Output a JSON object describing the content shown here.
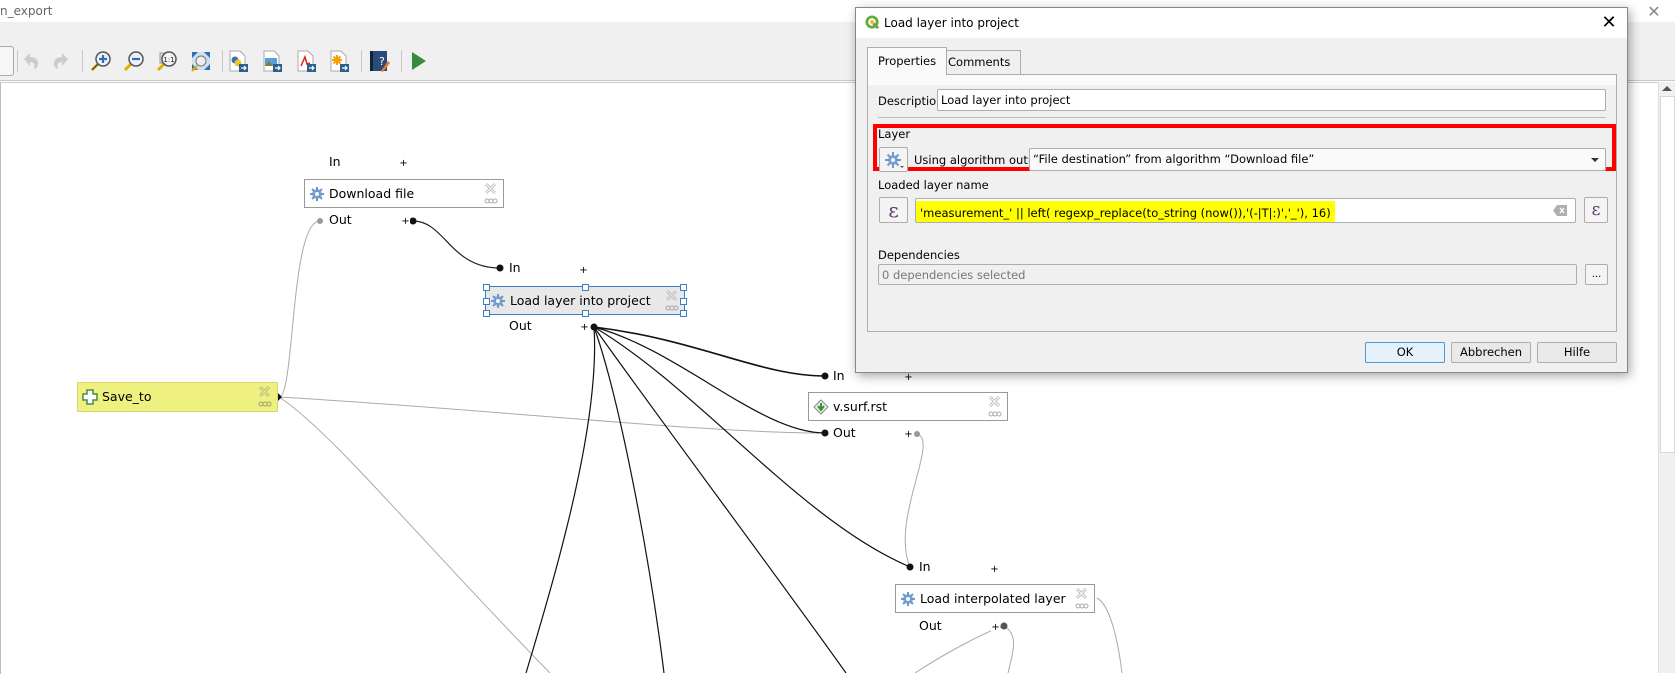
{
  "window": {
    "title": "n_export",
    "close_glyph": "✕"
  },
  "toolbar": {
    "items": [
      {
        "name": "undo",
        "icon": "undo-icon",
        "enabled": false
      },
      {
        "name": "redo",
        "icon": "redo-icon",
        "enabled": false
      },
      {
        "name": "zoom-in",
        "icon": "zoom-in-icon"
      },
      {
        "name": "zoom-out",
        "icon": "zoom-out-icon"
      },
      {
        "name": "zoom-actual",
        "icon": "zoom-actual-size-icon",
        "text": "1:1"
      },
      {
        "name": "zoom-full",
        "icon": "zoom-full-extent-icon"
      },
      {
        "name": "export-python",
        "icon": "export-python-icon"
      },
      {
        "name": "export-image",
        "icon": "export-image-icon"
      },
      {
        "name": "export-pdf",
        "icon": "export-pdf-icon"
      },
      {
        "name": "export-svg",
        "icon": "export-svg-icon"
      },
      {
        "name": "edit-help",
        "icon": "edit-help-icon"
      },
      {
        "name": "run-model",
        "icon": "run-icon"
      }
    ]
  },
  "canvas": {
    "nodes": [
      {
        "id": "download-file",
        "label": "Download file",
        "icon": "algorithm-gear-icon",
        "in_label": "In",
        "out_label": "Out"
      },
      {
        "id": "load-layer",
        "label": "Load layer into project",
        "icon": "algorithm-gear-icon",
        "in_label": "In",
        "out_label": "Out",
        "selected": true
      },
      {
        "id": "save-to",
        "label": "Save_to",
        "icon": "model-input-icon",
        "type": "input"
      },
      {
        "id": "v-surf-rst",
        "label": "v.surf.rst",
        "icon": "grass-icon",
        "in_label": "In",
        "out_label": "Out"
      },
      {
        "id": "load-interpolated",
        "label": "Load interpolated layer",
        "icon": "algorithm-gear-icon",
        "in_label": "In",
        "out_label": "Out"
      }
    ],
    "plus_glyph": "+"
  },
  "dialog": {
    "title": "Load layer into project",
    "close_glyph": "✕",
    "tabs": [
      {
        "label": "Properties",
        "active": true
      },
      {
        "label": "Comments",
        "active": false
      }
    ],
    "description": {
      "label": "Description",
      "value": "Load layer into project"
    },
    "layer": {
      "label": "Layer",
      "source_mode_label": "Using algorithm output",
      "selected_output": "“File destination” from algorithm “Download file”"
    },
    "loaded_layer_name": {
      "label": "Loaded layer name",
      "expression": "'measurement_' ||  left( regexp_replace(to_string (now()),'(-|T|:)','_'), 16)",
      "epsilon_glyph": "ε"
    },
    "dependencies": {
      "label": "Dependencies",
      "value": "0 dependencies selected",
      "browse_label": "..."
    },
    "buttons": {
      "ok": "OK",
      "cancel": "Abbrechen",
      "help": "Hilfe"
    },
    "highlight_color": "#ff0000",
    "expression_highlight_color": "#ffff00"
  }
}
